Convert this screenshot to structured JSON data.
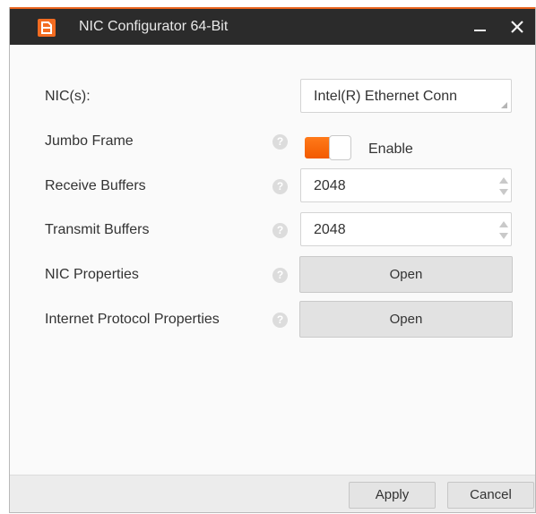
{
  "window": {
    "title": "NIC Configurator 64-Bit",
    "accent_color": "#f36c21",
    "titlebar_color": "#2b2b2b"
  },
  "rows": {
    "nic": {
      "label": "NIC(s):",
      "value": "Intel(R) Ethernet Conn"
    },
    "jumbo_frame": {
      "label": "Jumbo Frame",
      "toggle_label": "Enable",
      "enabled": true
    },
    "receive_buffers": {
      "label": "Receive Buffers",
      "value": "2048"
    },
    "transmit_buffers": {
      "label": "Transmit Buffers",
      "value": "2048"
    },
    "nic_properties": {
      "label": "NIC Properties",
      "button_label": "Open"
    },
    "ip_properties": {
      "label": "Internet Protocol Properties",
      "button_label": "Open"
    }
  },
  "help_icon_glyph": "?",
  "footer": {
    "apply_label": "Apply",
    "cancel_label": "Cancel"
  }
}
